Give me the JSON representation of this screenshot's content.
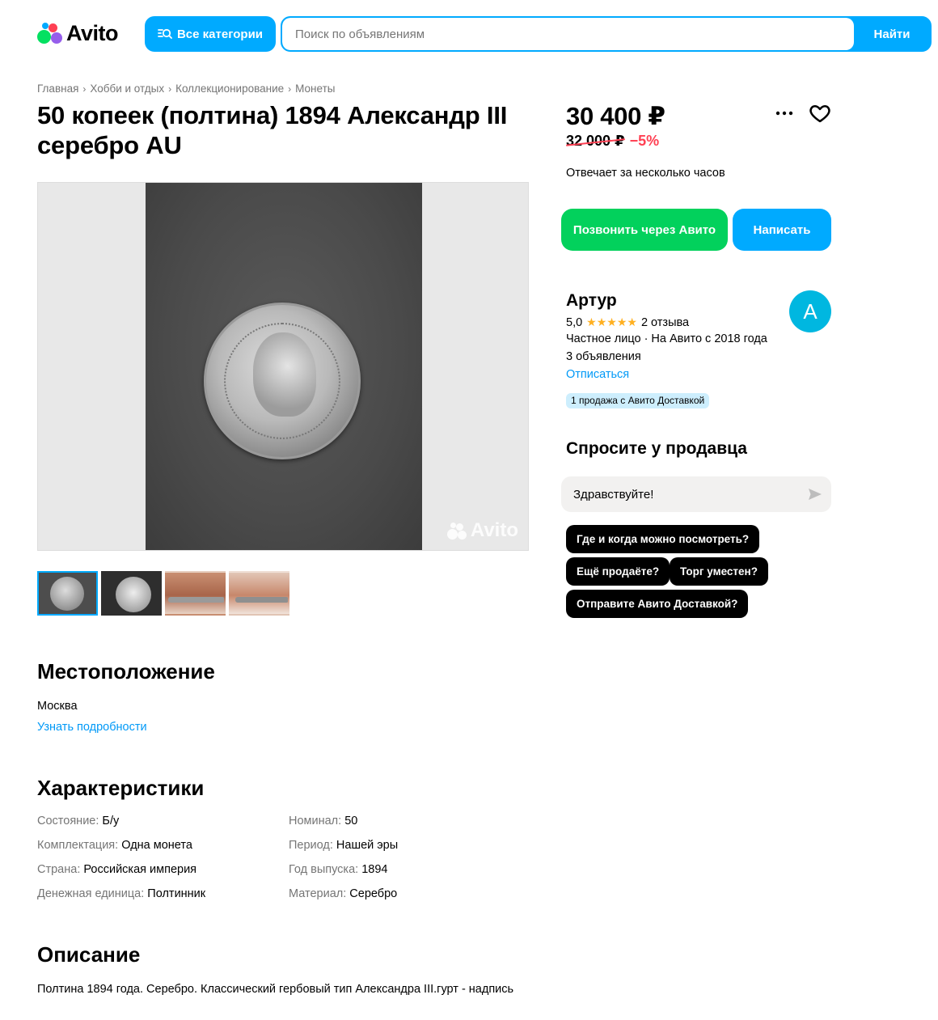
{
  "header": {
    "logo_text": "Avito",
    "categories_label": "Все категории",
    "search_placeholder": "Поиск по объявлениям",
    "search_button": "Найти"
  },
  "breadcrumb": [
    "Главная",
    "Хобби и отдых",
    "Коллекционирование",
    "Монеты"
  ],
  "listing": {
    "title": "50 копеек (полтина) 1894 Александр III серебро AU",
    "price": "30 400 ₽",
    "old_price": "32 000 ₽",
    "discount": "−5%",
    "response_time": "Отвечает за несколько часов",
    "watermark": "Avito",
    "thumbnail_count": 4,
    "active_thumbnail": 1
  },
  "actions": {
    "call_label": "Позвонить через Авито",
    "write_label": "Написать"
  },
  "seller": {
    "name": "Артур",
    "rating": "5,0",
    "stars": "★★★★★",
    "reviews": "2 отзыва",
    "type": "Частное лицо · На Авито с 2018 года",
    "listings": "3 объявления",
    "unsubscribe": "Отписаться",
    "delivery_badge": "1 продажа с Авито Доставкой",
    "avatar_letter": "А",
    "avatar_color": "#00b7e0"
  },
  "ask": {
    "title": "Спросите у продавца",
    "input_value": "Здравствуйте!",
    "quick_questions": [
      "Где и когда можно посмотреть?",
      "Ещё продаёте?",
      "Торг уместен?",
      "Отправите Авито Доставкой?"
    ]
  },
  "location": {
    "title": "Местоположение",
    "city": "Москва",
    "details_link": "Узнать подробности"
  },
  "specs": {
    "title": "Характеристики",
    "items": [
      {
        "key": "Состояние:",
        "value": "Б/у"
      },
      {
        "key": "Комплектация:",
        "value": "Одна монета"
      },
      {
        "key": "Страна:",
        "value": "Российская империя"
      },
      {
        "key": "Денежная единица:",
        "value": "Полтинник"
      },
      {
        "key": "Номинал:",
        "value": "50"
      },
      {
        "key": "Период:",
        "value": "Нашей эры"
      },
      {
        "key": "Год выпуска:",
        "value": "1894"
      },
      {
        "key": "Материал:",
        "value": "Серебро"
      }
    ]
  },
  "description": {
    "title": "Описание",
    "text": "Полтина 1894 года. Серебро. Классический гербовый тип Александра III.гурт - надпись"
  },
  "colors": {
    "accent": "#00aaff",
    "call_green": "#02d15c",
    "discount_red": "#ff4053",
    "link_blue": "#0099f7"
  }
}
